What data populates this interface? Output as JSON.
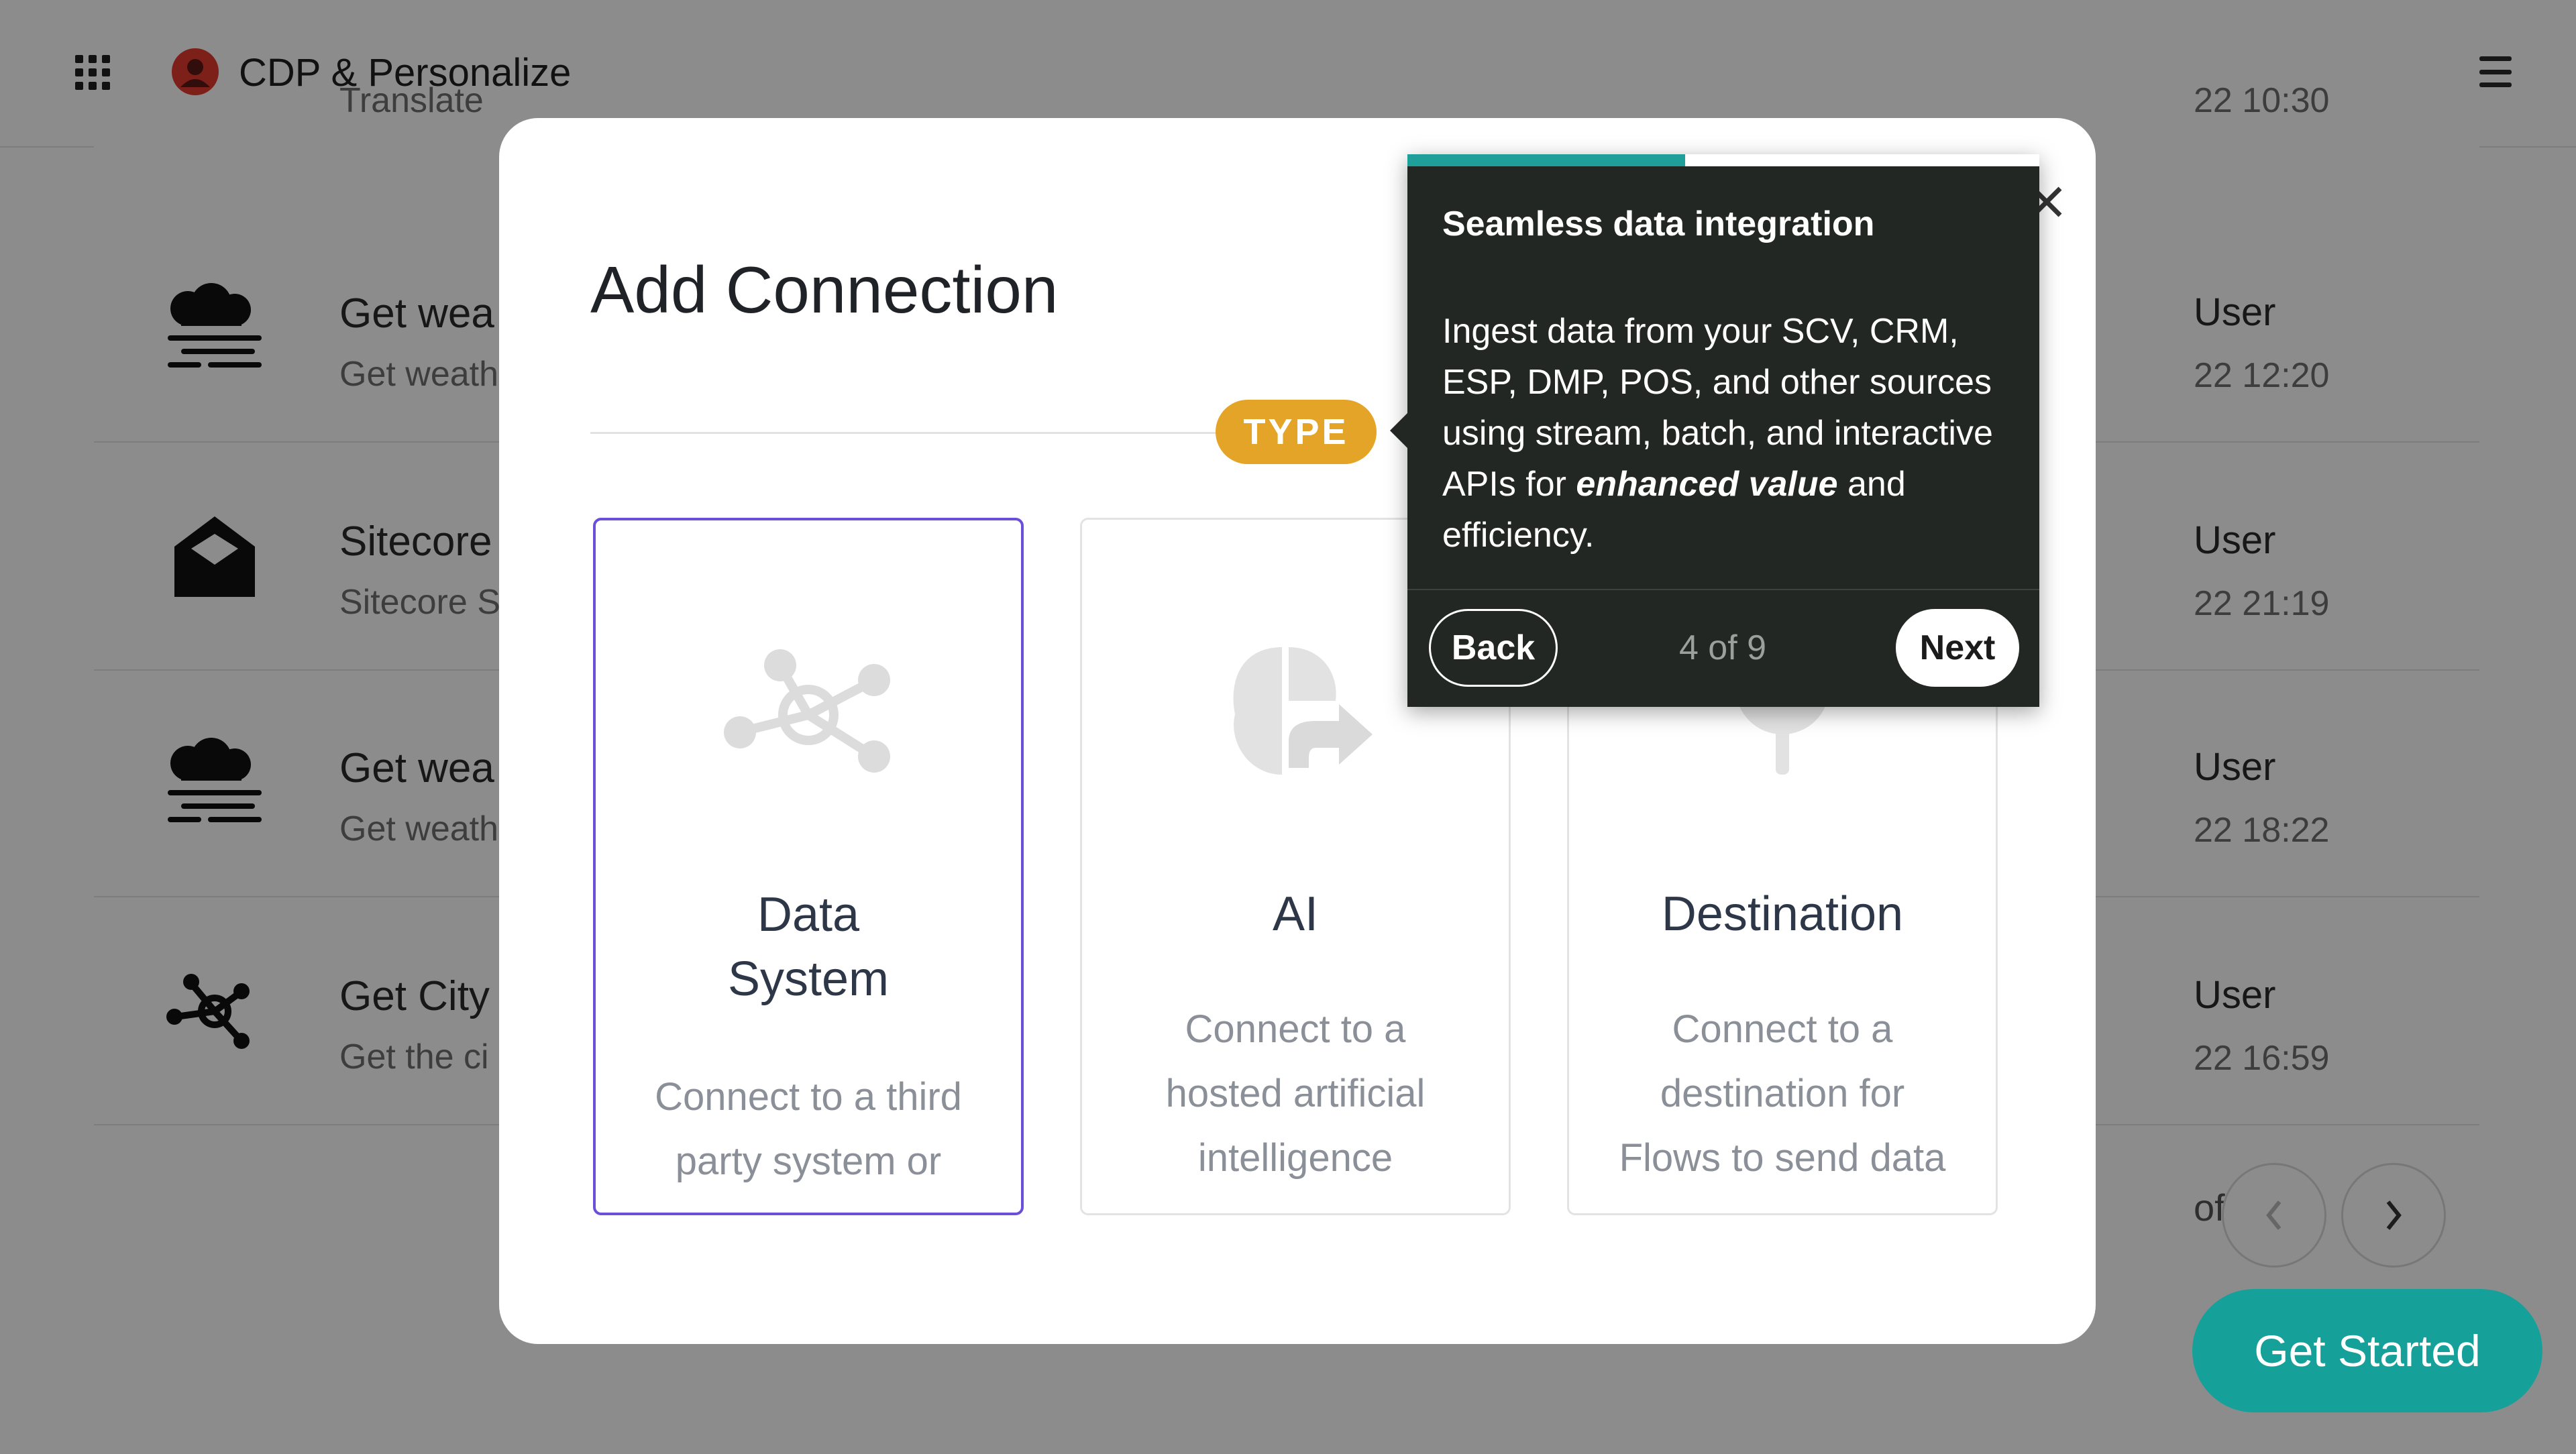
{
  "app": {
    "title": "CDP & Personalize"
  },
  "background_list": {
    "top_fragment": "Translate",
    "top_date_fragment": "22 10:30",
    "rows": [
      {
        "icon": "weather-cloud-icon",
        "title": "Get wea",
        "subtitle": "Get weath",
        "user": "User",
        "date": "22 12:20"
      },
      {
        "icon": "envelope-open-icon",
        "title": "Sitecore",
        "subtitle": "Sitecore S",
        "user": "User",
        "date": "22 21:19"
      },
      {
        "icon": "weather-cloud-icon",
        "title": "Get wea",
        "subtitle": "Get weath",
        "user": "User",
        "date": "22 18:22"
      },
      {
        "icon": "data-hub-icon",
        "title": "Get City",
        "subtitle": "Get the ci",
        "user": "User",
        "date": "22 16:59"
      }
    ],
    "pagination_text": "of 17"
  },
  "modal": {
    "title": "Add Connection",
    "step_badge": "TYPE",
    "options": [
      {
        "title": "Data System",
        "description": "Connect to a third party system or",
        "icon": "data-hub-icon",
        "selected": true
      },
      {
        "title": "AI",
        "description": "Connect to a hosted artificial intelligence",
        "icon": "brain-arrow-icon",
        "selected": false
      },
      {
        "title": "Destination",
        "description": "Connect to a destination for Flows to send data",
        "icon": "destination-pin-icon",
        "selected": false
      }
    ]
  },
  "tour": {
    "title": "Seamless data integration",
    "body_text": "Ingest data from your SCV, CRM, ESP, DMP, POS, and other sources using stream, batch, and interactive APIs for",
    "body_emphasis": "enhanced value",
    "body_end": "and efficiency.",
    "back_label": "Back",
    "next_label": "Next",
    "step_text": "4 of 9",
    "progress": 0.44
  },
  "cta": {
    "get_started_label": "Get Started"
  },
  "colors": {
    "accent": "#16a09a",
    "badge": "#e4a427",
    "selected_border": "#6b4fd8",
    "tooltip_bg": "#222723"
  }
}
